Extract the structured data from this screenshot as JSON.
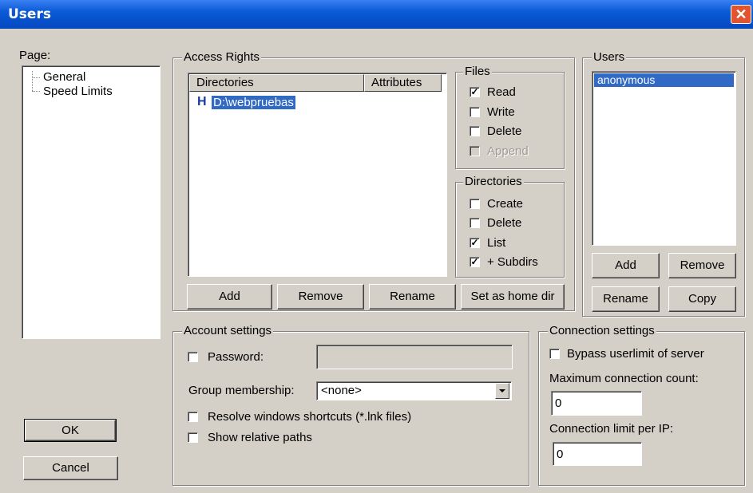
{
  "window": {
    "title": "Users",
    "close_glyph": "✕"
  },
  "page": {
    "label": "Page:",
    "tree": [
      {
        "label": "General"
      },
      {
        "label": "Speed Limits"
      }
    ]
  },
  "buttons": {
    "ok": "OK",
    "cancel": "Cancel"
  },
  "access_rights": {
    "title": "Access Rights",
    "columns": {
      "directories": "Directories",
      "attributes": "Attributes"
    },
    "rows": [
      {
        "flag": "H",
        "path": "D:\\webpruebas"
      }
    ],
    "buttons": {
      "add": "Add",
      "remove": "Remove",
      "rename": "Rename",
      "set_home": "Set as home dir"
    }
  },
  "files": {
    "title": "Files",
    "read": {
      "label": "Read",
      "checked": true
    },
    "write": {
      "label": "Write",
      "checked": false
    },
    "delete": {
      "label": "Delete",
      "checked": false
    },
    "append": {
      "label": "Append",
      "checked": false,
      "disabled": true
    }
  },
  "directories": {
    "title": "Directories",
    "create": {
      "label": "Create",
      "checked": false
    },
    "delete": {
      "label": "Delete",
      "checked": false
    },
    "list": {
      "label": "List",
      "checked": true
    },
    "subdirs": {
      "label": "+ Subdirs",
      "checked": true
    }
  },
  "users": {
    "title": "Users",
    "list": [
      "anonymous"
    ],
    "selected": "anonymous",
    "buttons": {
      "add": "Add",
      "remove": "Remove",
      "rename": "Rename",
      "copy": "Copy"
    }
  },
  "account": {
    "title": "Account settings",
    "password_label": "Password:",
    "password_value": "",
    "group_label": "Group membership:",
    "group_value": "<none>",
    "resolve_label": "Resolve windows shortcuts (*.lnk files)",
    "relative_label": "Show relative paths"
  },
  "connection": {
    "title": "Connection settings",
    "bypass_label": "Bypass userlimit of server",
    "max_label": "Maximum connection count:",
    "max_value": "0",
    "per_ip_label": "Connection limit per IP:",
    "per_ip_value": "0"
  },
  "colors": {
    "selection": "#316ac5",
    "title_bar": "#0a5ad6",
    "dialog": "#d4d0c8"
  }
}
